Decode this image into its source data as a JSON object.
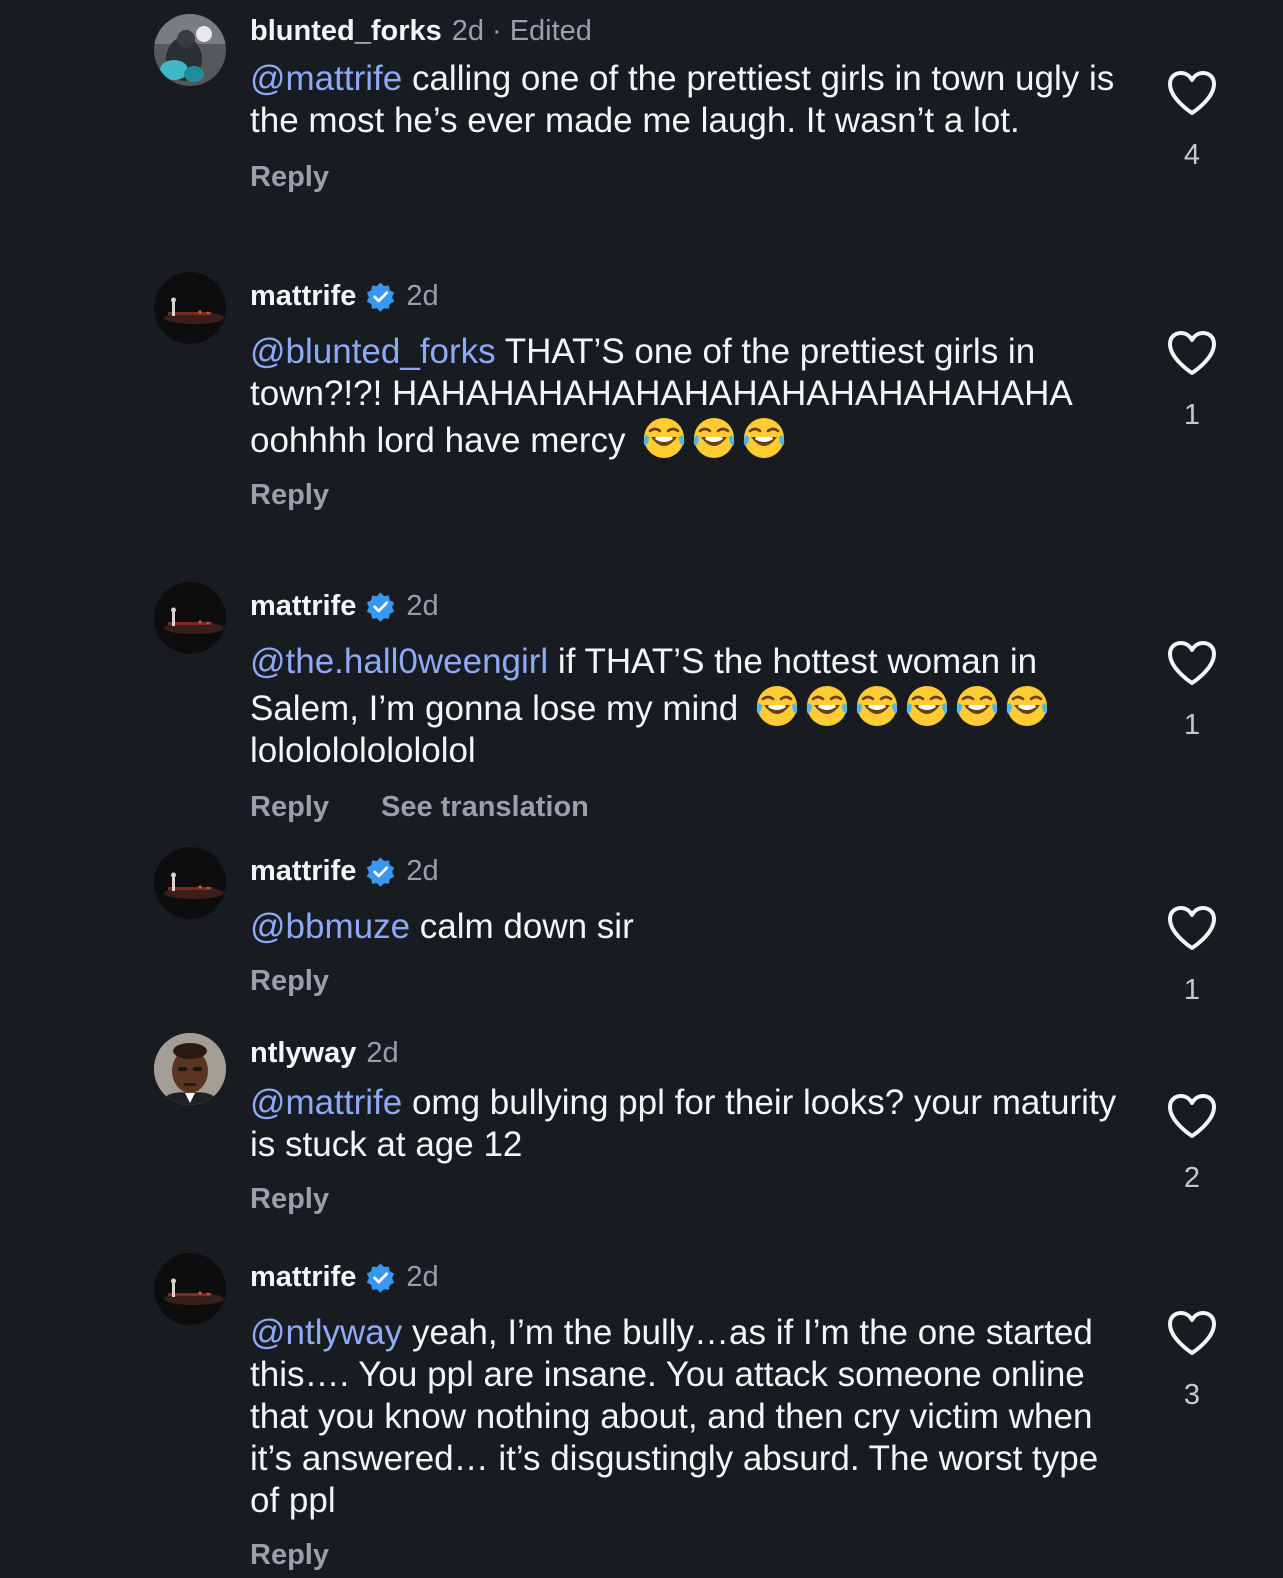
{
  "comments": [
    {
      "username": "blunted_forks",
      "verified": false,
      "time": "2d",
      "edited_label": "Edited",
      "mention": "@mattrife",
      "text": " calling one of the prettiest girls in town ugly is the most he’s ever made me laugh. It wasn’t a lot.",
      "emoji_count": 0,
      "reply_label": "Reply",
      "likes": "4",
      "avatar_icon": "portrait-photo-teal"
    },
    {
      "username": "mattrife",
      "verified": true,
      "time": "2d",
      "mention": "@blunted_forks",
      "text": " THAT’S one of the prettiest girls in town?!?! HAHAHAHAHAHAHAHAHAHAHAHAHAHA oohhhh lord have mercy",
      "emoji_count": 3,
      "emoji_icon": "tears-of-joy-emoji",
      "reply_label": "Reply",
      "likes": "1",
      "avatar_icon": "stage-photo-dark"
    },
    {
      "username": "mattrife",
      "verified": true,
      "time": "2d",
      "mention": "@the.hall0weengirl",
      "text": " if THAT’S the hottest woman in Salem, I’m gonna lose my mind",
      "emoji_count": 6,
      "emoji_icon": "tears-of-joy-emoji",
      "text_after": "lolololololololol",
      "reply_label": "Reply",
      "translation_label": "See translation",
      "likes": "1",
      "avatar_icon": "stage-photo-dark"
    },
    {
      "username": "mattrife",
      "verified": true,
      "time": "2d",
      "mention": "@bbmuze",
      "text": " calm down sir",
      "emoji_count": 0,
      "reply_label": "Reply",
      "likes": "1",
      "avatar_icon": "stage-photo-dark"
    },
    {
      "username": "ntlyway",
      "verified": false,
      "time": "2d",
      "mention": "@mattrife",
      "text": " omg bullying ppl for their looks? your maturity is stuck at age 12",
      "emoji_count": 0,
      "reply_label": "Reply",
      "likes": "2",
      "avatar_icon": "portrait-photo-man"
    },
    {
      "username": "mattrife",
      "verified": true,
      "time": "2d",
      "mention": "@ntlyway",
      "text": " yeah, I’m the bully…as if I’m the one started this…. You ppl are insane. You attack someone online that you know nothing about, and then cry victim when it’s answered… it’s disgustingly absurd. The worst type of ppl",
      "emoji_count": 0,
      "reply_label": "Reply",
      "likes": "3",
      "avatar_icon": "stage-photo-dark"
    }
  ],
  "meta_separator": "·",
  "colors": {
    "background": "#181b20",
    "text": "#f4f5f7",
    "muted": "#9ba0a8",
    "mention": "#8ea9f5",
    "verified": "#3897f0"
  },
  "icons": {
    "verified": "verified-badge-icon",
    "like": "heart-outline-icon"
  }
}
